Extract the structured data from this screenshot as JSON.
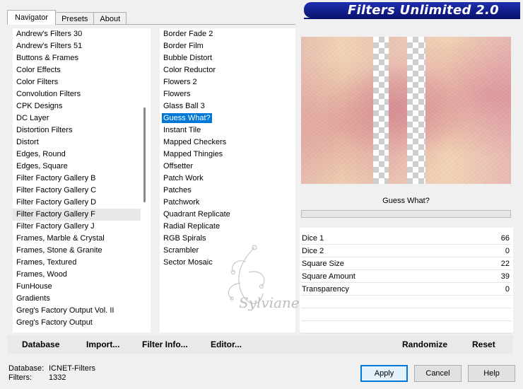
{
  "tabs": [
    {
      "label": "Navigator",
      "active": true
    },
    {
      "label": "Presets",
      "active": false
    },
    {
      "label": "About",
      "active": false
    }
  ],
  "banner": {
    "title": "Filters Unlimited 2.0",
    "color": "#0a1370"
  },
  "categories": [
    "Andrew's Filters 30",
    "Andrew's Filters 51",
    "Buttons & Frames",
    "Color Effects",
    "Color Filters",
    "Convolution Filters",
    "CPK Designs",
    "DC Layer",
    "Distortion Filters",
    "Distort",
    "Edges, Round",
    "Edges, Square",
    "Filter Factory Gallery B",
    "Filter Factory Gallery C",
    "Filter Factory Gallery D",
    "Filter Factory Gallery F",
    "Filter Factory Gallery J",
    "Frames, Marble & Crystal",
    "Frames, Stone & Granite",
    "Frames, Textured",
    "Frames, Wood",
    "FunHouse",
    "Gradients",
    "Greg's Factory Output Vol. II",
    "Greg's Factory Output"
  ],
  "selected_category": "Filter Factory Gallery F",
  "filters": [
    "Border Fade 2",
    "Border Film",
    "Bubble Distort",
    "Color Reductor",
    "Flowers 2",
    "Flowers",
    "Glass Ball 3",
    "Guess What?",
    "Instant Tile",
    "Mapped Checkers",
    "Mapped Thingies",
    "Offsetter",
    "Patch Work",
    "Patches",
    "Patchwork",
    "Quadrant Replicate",
    "Radial Replicate",
    "RGB Spirals",
    "Scrambler",
    "Sector Mosaic"
  ],
  "selected_filter": "Guess What?",
  "preview_title": "Guess What?",
  "params": [
    {
      "label": "Dice 1",
      "value": "66"
    },
    {
      "label": "Dice 2",
      "value": "0"
    },
    {
      "label": "Square Size",
      "value": "22"
    },
    {
      "label": "Square Amount",
      "value": "39"
    },
    {
      "label": "Transparency",
      "value": "0"
    }
  ],
  "toolbar": {
    "database": "Database",
    "import": "Import...",
    "filter_info": "Filter Info...",
    "editor": "Editor...",
    "randomize": "Randomize",
    "reset": "Reset"
  },
  "status": {
    "database_label": "Database:",
    "database_value": "ICNET-Filters",
    "filters_label": "Filters:",
    "filters_value": "1332"
  },
  "buttons": {
    "apply": "Apply",
    "cancel": "Cancel",
    "help": "Help"
  },
  "watermark": "Sylviane"
}
